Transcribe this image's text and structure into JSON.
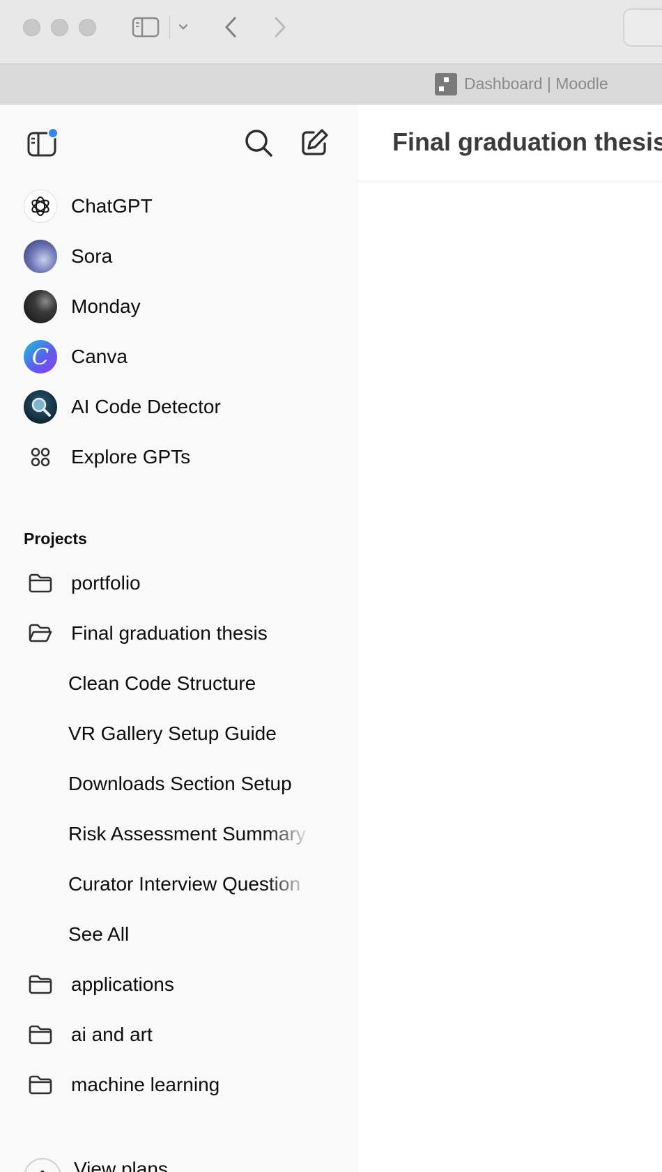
{
  "browser": {
    "tab_title": "Dashboard | Moodle",
    "icons": [
      "close-light",
      "minimize-light",
      "zoom-light",
      "sidebar-toggle-icon",
      "chevron-down-icon",
      "back-arrow-icon",
      "forward-arrow-icon"
    ]
  },
  "sidebar": {
    "top_icons": [
      "sidebar-panel-icon",
      "search-icon",
      "new-chat-icon"
    ],
    "notification_color": "#3b82f6",
    "gpts": [
      {
        "label": "ChatGPT",
        "icon": "openai-logo-icon"
      },
      {
        "label": "Sora",
        "icon": "sora-avatar"
      },
      {
        "label": "Monday",
        "icon": "monday-avatar"
      },
      {
        "label": "Canva",
        "icon": "canva-avatar"
      },
      {
        "label": "AI Code Detector",
        "icon": "ai-code-detector-avatar"
      },
      {
        "label": "Explore GPTs",
        "icon": "grid-icon"
      }
    ],
    "projects_heading": "Projects",
    "projects": [
      {
        "label": "portfolio",
        "icon": "folder-icon"
      },
      {
        "label": "Final graduation thesis",
        "icon": "folder-open-icon"
      }
    ],
    "thesis_chats": [
      "Clean Code Structure",
      "VR Gallery Setup Guide",
      "Downloads Section Setup",
      "Risk Assessment Summary",
      "Curator Interview Question",
      "See All"
    ],
    "more_projects": [
      {
        "label": "applications",
        "icon": "folder-icon"
      },
      {
        "label": "ai and art",
        "icon": "folder-icon"
      },
      {
        "label": "machine learning",
        "icon": "folder-icon"
      }
    ],
    "footer": {
      "label": "View plans"
    }
  },
  "main": {
    "title": "Final graduation thesis"
  }
}
